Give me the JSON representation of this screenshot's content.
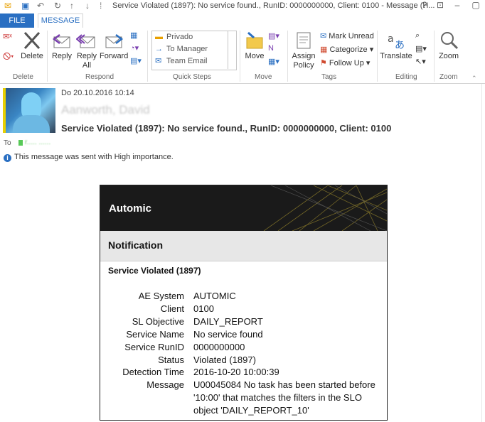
{
  "window": {
    "title": "Service Violated (1897): No service found., RunID: 0000000000, Client: 0100 - Message (H...",
    "help": "?"
  },
  "tabs": {
    "file": "FILE",
    "message": "MESSAGE"
  },
  "ribbon": {
    "delete_group": {
      "label": "Delete",
      "delete": "Delete"
    },
    "respond_group": {
      "label": "Respond",
      "reply": "Reply",
      "reply_all_1": "Reply",
      "reply_all_2": "All",
      "forward": "Forward"
    },
    "quicksteps_group": {
      "label": "Quick Steps",
      "items": [
        "Privado",
        "To Manager",
        "Team Email"
      ]
    },
    "move_group": {
      "label": "Move",
      "move": "Move"
    },
    "tags_group": {
      "label": "Tags",
      "assign_1": "Assign",
      "assign_2": "Policy",
      "mark_unread": "Mark Unread",
      "categorize": "Categorize",
      "follow_up": "Follow Up"
    },
    "editing_group": {
      "label": "Editing",
      "translate": "Translate"
    },
    "zoom_group": {
      "label": "Zoom",
      "zoom": "Zoom"
    }
  },
  "message": {
    "date": "Do 20.10.2016 10:14",
    "sender": "Aanworth, David",
    "subject": "Service Violated (1897): No service found., RunID: 0000000000, Client: 0100",
    "to_label": "To",
    "to_name": "r..... ......",
    "importance": "This message was sent with High importance."
  },
  "email_body": {
    "brand": "Automic",
    "heading": "Notification",
    "service_title": "Service Violated (1897)",
    "fields": [
      {
        "key": "AE System",
        "value": "AUTOMIC"
      },
      {
        "key": "Client",
        "value": "0100"
      },
      {
        "key": "SL Objective",
        "value": "DAILY_REPORT"
      },
      {
        "key": "Service Name",
        "value": "No service found"
      },
      {
        "key": "Service RunID",
        "value": "0000000000"
      },
      {
        "key": "Status",
        "value": "Violated (1897)"
      },
      {
        "key": "Detection Time",
        "value": "2016-10-20 10:00:39"
      }
    ],
    "message_key": "Message",
    "message_value": "U00045084 No task has been started before '10:00' that matches the filters in the SLO object 'DAILY_REPORT_10'"
  },
  "colors": {
    "accent": "#2a6fc2",
    "banner": "#1a1a1a",
    "notif_bar": "#e7e7e7"
  }
}
